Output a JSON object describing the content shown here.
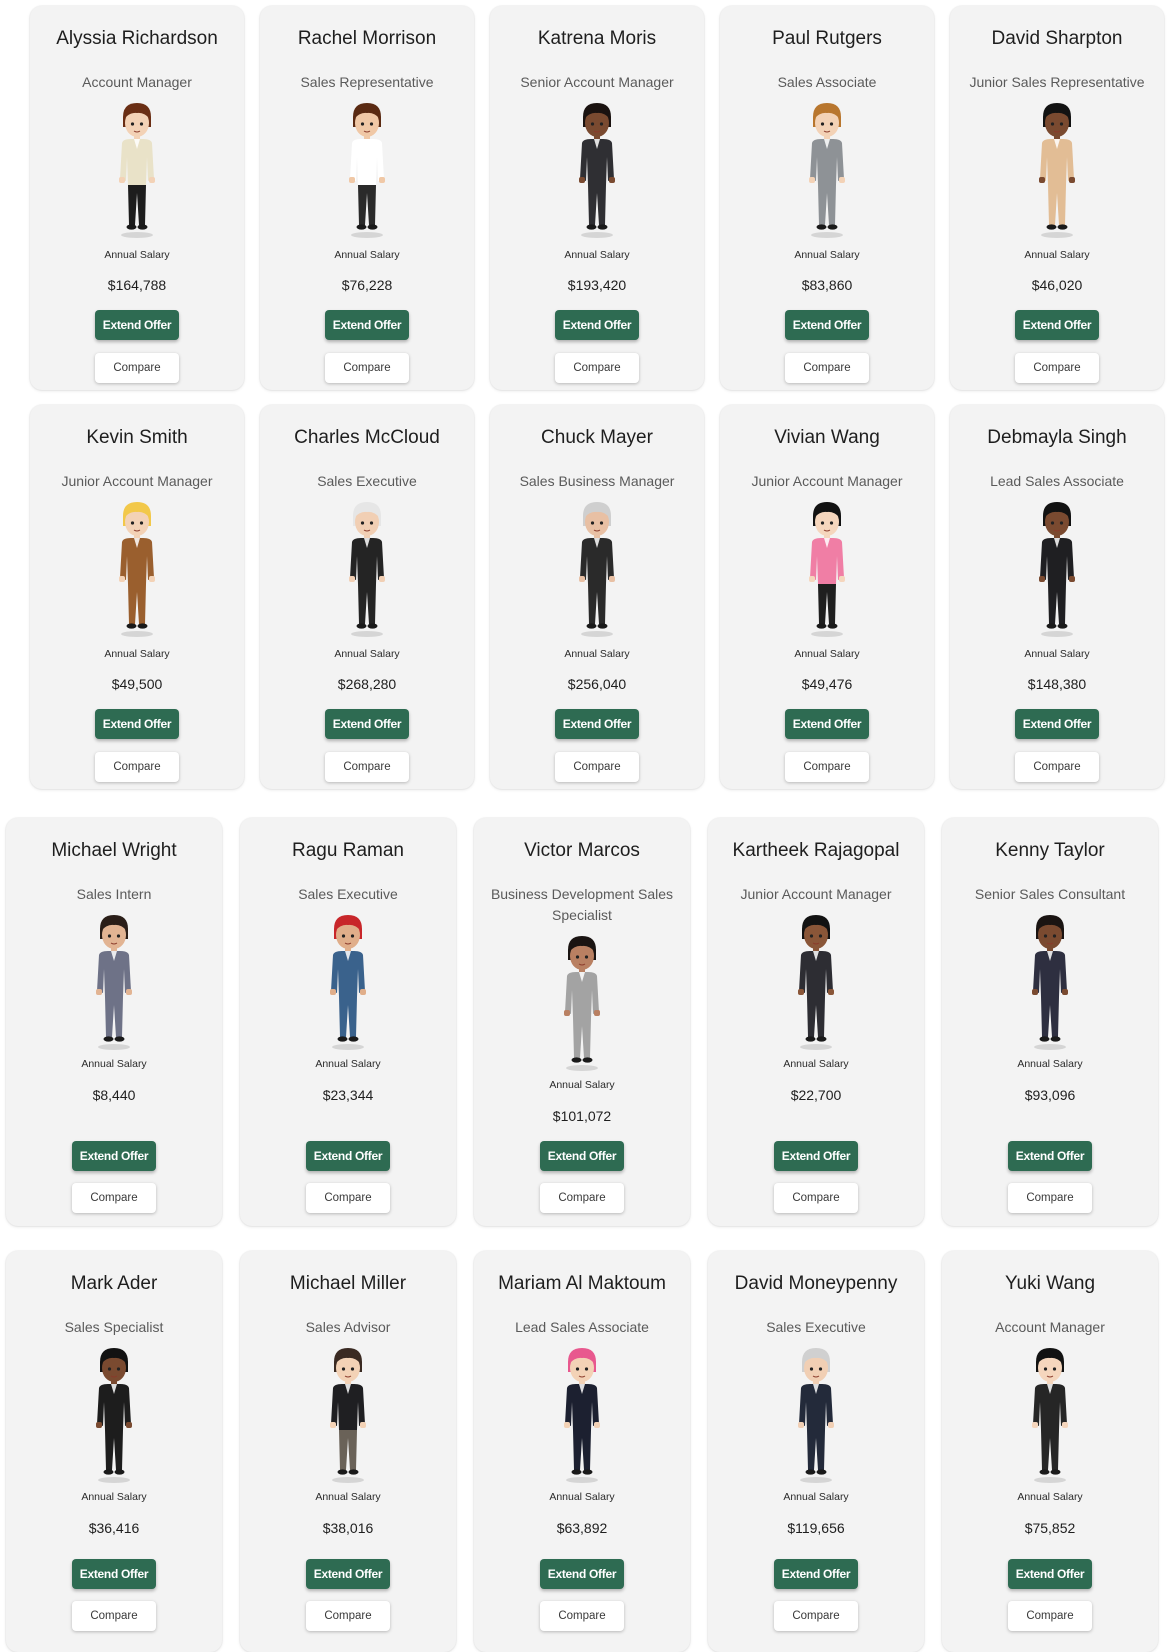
{
  "labels": {
    "salary": "Annual Salary",
    "extend_offer": "Extend Offer",
    "compare": "Compare"
  },
  "colors": {
    "accent": "#2e6b52",
    "card_bg": "#f3f3f3",
    "page_bg": "#ffffff"
  },
  "candidates": [
    {
      "name": "Alyssia Richardson",
      "role": "Account Manager",
      "salary": "$164,788",
      "hair": "#6a2e14",
      "skin": "#f3d2b6",
      "top": "#e9e2c8",
      "bottom": "#1d1d1d"
    },
    {
      "name": "Rachel Morrison",
      "role": "Sales Representative",
      "salary": "$76,228",
      "hair": "#5a2a12",
      "skin": "#f0c8a6",
      "top": "#ffffff",
      "bottom": "#2a2a2a"
    },
    {
      "name": "Katrena Moris",
      "role": "Senior Account Manager",
      "salary": "$193,420",
      "hair": "#1a1210",
      "skin": "#7a4a30",
      "top": "#2f2f33",
      "bottom": "#2f2f33"
    },
    {
      "name": "Paul Rutgers",
      "role": "Sales Associate",
      "salary": "$83,860",
      "hair": "#b8762e",
      "skin": "#f3d2b6",
      "top": "#8e9296",
      "bottom": "#8e9296"
    },
    {
      "name": "David Sharpton",
      "role": "Junior Sales Representative",
      "salary": "$46,020",
      "hair": "#121212",
      "skin": "#7a4a30",
      "top": "#e2bd95",
      "bottom": "#e2bd95"
    },
    {
      "name": "Kevin Smith",
      "role": "Junior Account Manager",
      "salary": "$49,500",
      "hair": "#f2c84a",
      "skin": "#f3d2b6",
      "top": "#9a5f2e",
      "bottom": "#9a5f2e"
    },
    {
      "name": "Charles McCloud",
      "role": "Sales Executive",
      "salary": "$268,280",
      "hair": "#e6e6e6",
      "skin": "#f1cfb4",
      "top": "#242424",
      "bottom": "#242424"
    },
    {
      "name": "Chuck Mayer",
      "role": "Sales Business Manager",
      "salary": "$256,040",
      "hair": "#cfcfcf",
      "skin": "#e8c0a4",
      "top": "#2a2a2a",
      "bottom": "#2a2a2a"
    },
    {
      "name": "Vivian Wang",
      "role": "Junior Account Manager",
      "salary": "$49,476",
      "hair": "#121212",
      "skin": "#f5d6bd",
      "top": "#f07ea5",
      "bottom": "#1f1f1f"
    },
    {
      "name": "Debmayla Singh",
      "role": "Lead Sales Associate",
      "salary": "$148,380",
      "hair": "#121212",
      "skin": "#7a4a30",
      "top": "#1f1f22",
      "bottom": "#1f1f22"
    },
    {
      "name": "Michael Wright",
      "role": "Sales Intern",
      "salary": "$8,440",
      "hair": "#2a1e18",
      "skin": "#e2b493",
      "top": "#6e7287",
      "bottom": "#6e7287"
    },
    {
      "name": "Ragu Raman",
      "role": "Sales Executive",
      "salary": "$23,344",
      "hair": "#c8262a",
      "skin": "#e0ae8a",
      "top": "#3a628c",
      "bottom": "#3a628c"
    },
    {
      "name": "Victor Marcos",
      "role": "Business Development Sales Specialist",
      "salary": "$101,072",
      "hair": "#1a1412",
      "skin": "#b98062",
      "top": "#a3a3a3",
      "bottom": "#a3a3a3"
    },
    {
      "name": "Kartheek Rajagopal",
      "role": "Junior Account Manager",
      "salary": "$22,700",
      "hair": "#121212",
      "skin": "#8a5638",
      "top": "#2d2d33",
      "bottom": "#2d2d33"
    },
    {
      "name": "Kenny Taylor",
      "role": "Senior Sales Consultant",
      "salary": "$93,096",
      "hair": "#1a1412",
      "skin": "#7a4a30",
      "top": "#2e2f40",
      "bottom": "#2e2f40"
    },
    {
      "name": "Mark Ader",
      "role": "Sales Specialist",
      "salary": "$36,416",
      "hair": "#121212",
      "skin": "#7a4a30",
      "top": "#1d1d1d",
      "bottom": "#1d1d1d"
    },
    {
      "name": "Michael Miller",
      "role": "Sales Advisor",
      "salary": "$38,016",
      "hair": "#3a2a22",
      "skin": "#f3d2b6",
      "top": "#1f1f22",
      "bottom": "#6a6258"
    },
    {
      "name": "Mariam Al Maktoum",
      "role": "Lead Sales Associate",
      "salary": "$63,892",
      "hair": "#e8588e",
      "skin": "#f3d2b6",
      "top": "#1c2030",
      "bottom": "#1c2030"
    },
    {
      "name": "David Moneypenny",
      "role": "Sales Executive",
      "salary": "$119,656",
      "hair": "#d0d0d0",
      "skin": "#f1cfb4",
      "top": "#232a3a",
      "bottom": "#232a3a"
    },
    {
      "name": "Yuki Wang",
      "role": "Account Manager",
      "salary": "$75,852",
      "hair": "#121212",
      "skin": "#f5d6bd",
      "top": "#262626",
      "bottom": "#262626"
    }
  ]
}
